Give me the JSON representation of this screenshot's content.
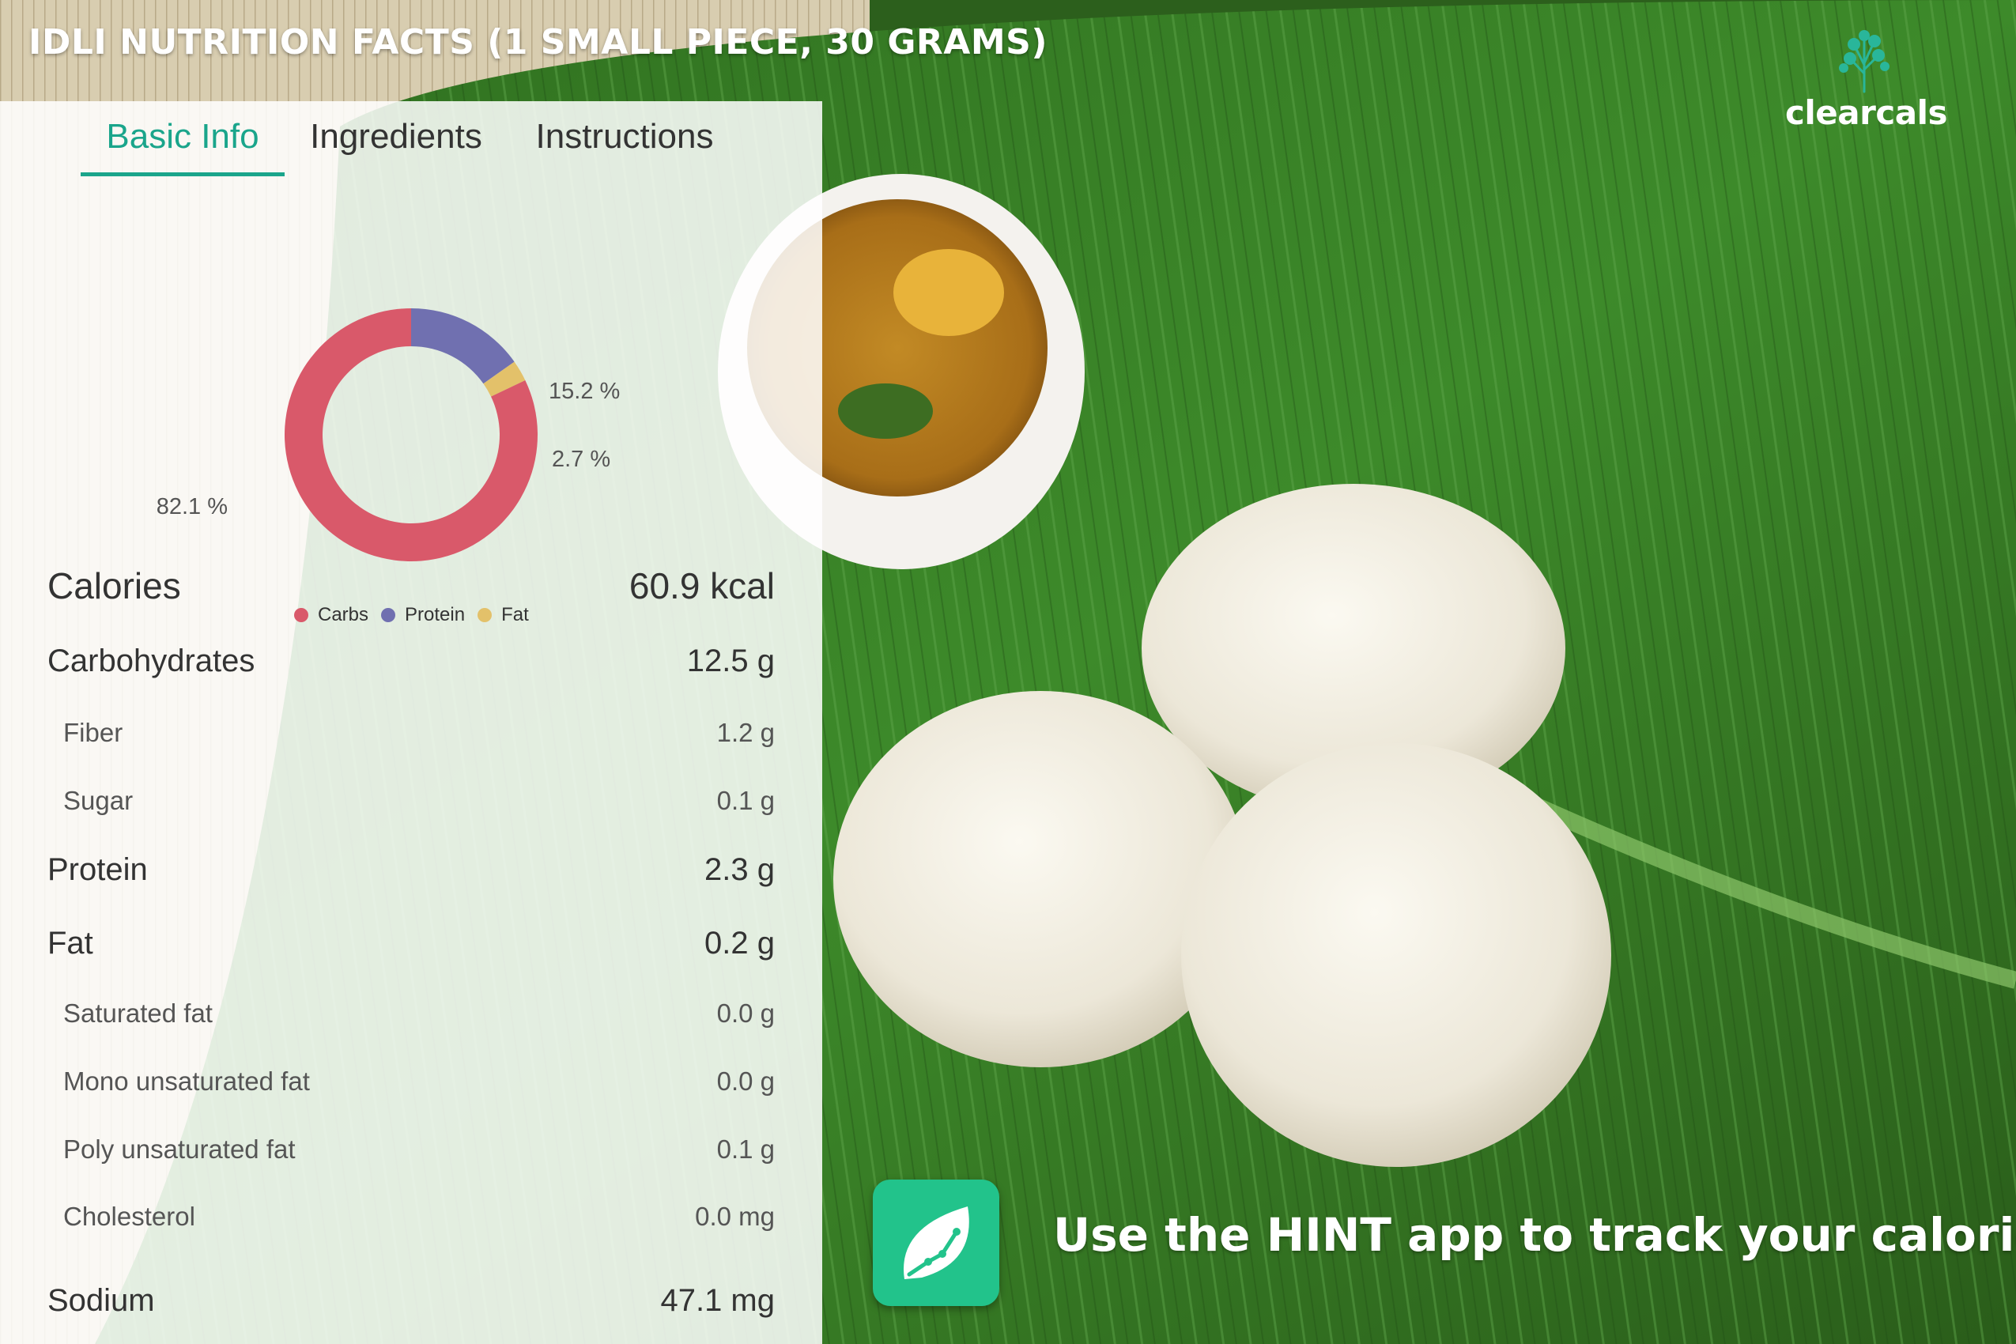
{
  "title": "IDLI NUTRITION FACTS (1 SMALL PIECE, 30 GRAMS)",
  "brand": {
    "name": "clearcals",
    "logo_icon": "tree-logo-icon"
  },
  "tabs": [
    {
      "label": "Basic Info",
      "active": true
    },
    {
      "label": "Ingredients",
      "active": false
    },
    {
      "label": "Instructions",
      "active": false
    }
  ],
  "chart_data": {
    "type": "pie",
    "donut": true,
    "categories": [
      "Carbs",
      "Protein",
      "Fat"
    ],
    "values": [
      82.1,
      15.2,
      2.7
    ],
    "labels": [
      "82.1 %",
      "15.2 %",
      "2.7 %"
    ],
    "colors": [
      "#d9596a",
      "#7070b0",
      "#e3c16a"
    ],
    "legend_position": "bottom"
  },
  "nutrition": {
    "calories": {
      "label": "Calories",
      "value": "60.9 kcal"
    },
    "carbohydrates": {
      "label": "Carbohydrates",
      "value": "12.5 g"
    },
    "fiber": {
      "label": "Fiber",
      "value": "1.2 g"
    },
    "sugar": {
      "label": "Sugar",
      "value": "0.1 g"
    },
    "protein": {
      "label": "Protein",
      "value": "2.3 g"
    },
    "fat": {
      "label": "Fat",
      "value": "0.2 g"
    },
    "saturated_fat": {
      "label": "Saturated fat",
      "value": "0.0 g"
    },
    "mono_fat": {
      "label": "Mono unsaturated fat",
      "value": "0.0 g"
    },
    "poly_fat": {
      "label": "Poly unsaturated fat",
      "value": "0.1 g"
    },
    "cholesterol": {
      "label": "Cholesterol",
      "value": "0.0 mg"
    },
    "sodium": {
      "label": "Sodium",
      "value": "47.1 mg"
    }
  },
  "cta": {
    "text": "Use the HINT app to track your calories",
    "app_icon": "hint-leaf-icon"
  }
}
